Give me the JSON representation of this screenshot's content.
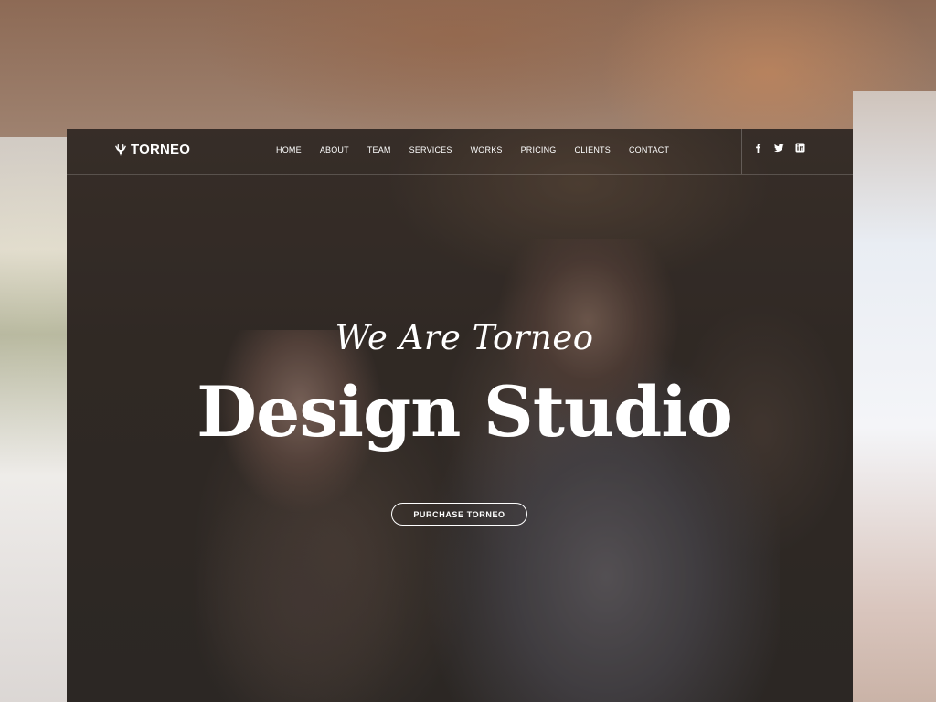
{
  "brand": {
    "name": "TORNEO",
    "icon": "deer-antlers-icon"
  },
  "nav": {
    "items": [
      {
        "label": "HOME"
      },
      {
        "label": "ABOUT"
      },
      {
        "label": "TEAM"
      },
      {
        "label": "SERVICES"
      },
      {
        "label": "WORKS"
      },
      {
        "label": "PRICING"
      },
      {
        "label": "CLIENTS"
      },
      {
        "label": "CONTACT"
      }
    ]
  },
  "social": [
    {
      "icon": "facebook-icon"
    },
    {
      "icon": "twitter-icon"
    },
    {
      "icon": "linkedin-icon"
    }
  ],
  "hero": {
    "subtitle": "We Are Torneo",
    "title": "Design Studio",
    "cta_label": "PURCHASE TORNEO"
  },
  "colors": {
    "text": "#ffffff",
    "overlay": "#14100e"
  }
}
